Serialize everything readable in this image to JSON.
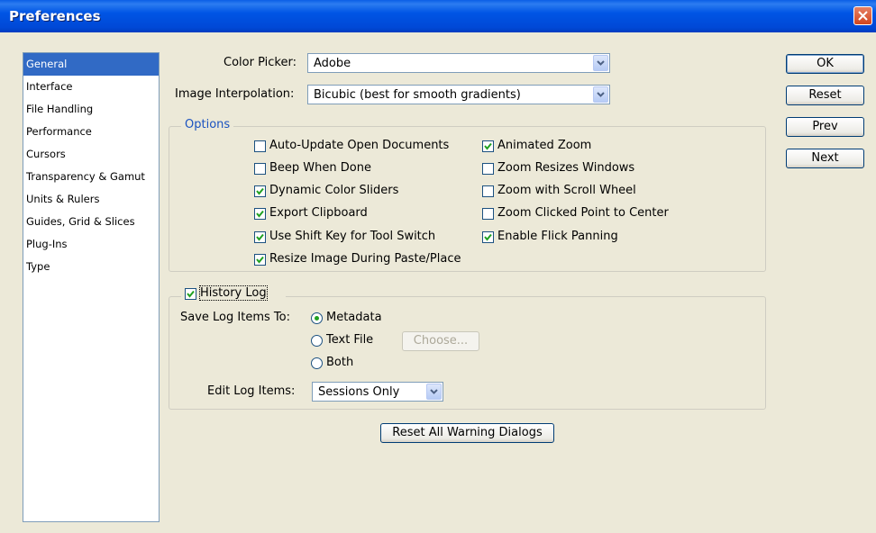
{
  "window": {
    "title": "Preferences"
  },
  "sidebar": {
    "items": [
      {
        "label": "General"
      },
      {
        "label": "Interface"
      },
      {
        "label": "File Handling"
      },
      {
        "label": "Performance"
      },
      {
        "label": "Cursors"
      },
      {
        "label": "Transparency & Gamut"
      },
      {
        "label": "Units & Rulers"
      },
      {
        "label": "Guides, Grid & Slices"
      },
      {
        "label": "Plug-Ins"
      },
      {
        "label": "Type"
      }
    ]
  },
  "general": {
    "color_picker_label": "Color Picker:",
    "color_picker_value": "Adobe",
    "interp_label": "Image Interpolation:",
    "interp_value": "Bicubic (best for smooth gradients)"
  },
  "options": {
    "legend": "Options",
    "left": [
      {
        "label": "Auto-Update Open Documents",
        "checked": false
      },
      {
        "label": "Beep When Done",
        "checked": false
      },
      {
        "label": "Dynamic Color Sliders",
        "checked": true
      },
      {
        "label": "Export Clipboard",
        "checked": true
      },
      {
        "label": "Use Shift Key for Tool Switch",
        "checked": true
      },
      {
        "label": "Resize Image During Paste/Place",
        "checked": true
      }
    ],
    "right": [
      {
        "label": "Animated Zoom",
        "checked": true
      },
      {
        "label": "Zoom Resizes Windows",
        "checked": false
      },
      {
        "label": "Zoom with Scroll Wheel",
        "checked": false
      },
      {
        "label": "Zoom Clicked Point to Center",
        "checked": false
      },
      {
        "label": "Enable Flick Panning",
        "checked": true
      }
    ]
  },
  "history": {
    "legend": "History Log",
    "checked": true,
    "save_label": "Save Log Items To:",
    "radios": [
      {
        "label": "Metadata",
        "selected": true
      },
      {
        "label": "Text File",
        "selected": false
      },
      {
        "label": "Both",
        "selected": false
      }
    ],
    "choose_label": "Choose...",
    "edit_label": "Edit Log Items:",
    "edit_value": "Sessions Only"
  },
  "reset_warnings_label": "Reset All Warning Dialogs",
  "buttons": {
    "ok": "OK",
    "reset": "Reset",
    "prev": "Prev",
    "next": "Next"
  }
}
